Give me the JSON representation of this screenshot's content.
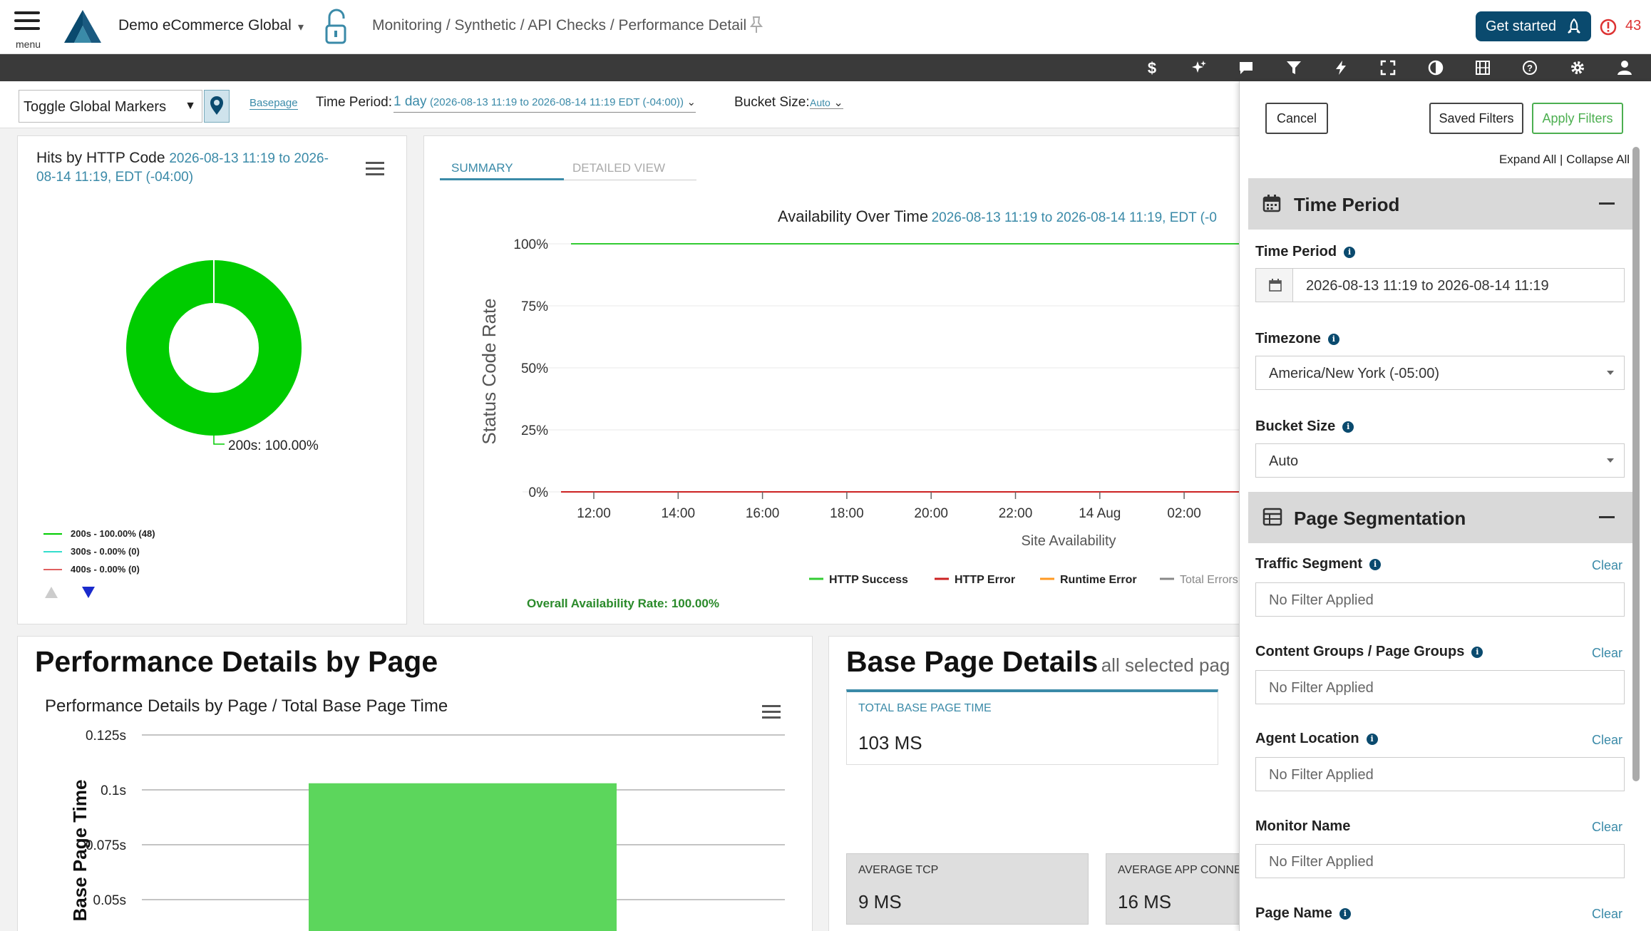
{
  "header": {
    "menu_label": "menu",
    "org_name": "Demo eCommerce Global",
    "breadcrumb": "Monitoring / Synthetic / API Checks / Performance Detail",
    "get_started": "Get started",
    "alert_count": "43",
    "colors": {
      "brand": "#0a4a6e",
      "alert": "#dd3333"
    }
  },
  "toolbar": {
    "icons": [
      "dollar-icon",
      "sparkle-icon",
      "comment-icon",
      "filter-icon",
      "lightning-icon",
      "fullscreen-icon",
      "contrast-icon",
      "film-icon",
      "help-icon",
      "gear-icon",
      "user-icon"
    ]
  },
  "filter_bar": {
    "markers_label": "Toggle Global Markers",
    "basepage_link": "Basepage",
    "time_period_label": "Time Period:",
    "time_period_value": "1 day",
    "time_period_range": "(2026-08-13 11:19 to 2026-08-14 11:19 EDT (-04:00))",
    "bucket_size_label": "Bucket Size:",
    "bucket_size_value": "Auto"
  },
  "http_card": {
    "title": "Hits by HTTP Code",
    "subtitle": "2026-08-13 11:19 to 2026-08-14 11:19, EDT (-04:00)",
    "chart_data": {
      "type": "pie",
      "labels": [
        "200s",
        "300s",
        "400s"
      ],
      "values": [
        100.0,
        0.0,
        0.0
      ],
      "counts": [
        48,
        0,
        0
      ],
      "colors": [
        "#00cc00",
        "#33ddcc",
        "#e06060"
      ],
      "slice_label": "200s: 100.00%",
      "legend": [
        "200s - 100.00% (48)",
        "300s - 0.00% (0)",
        "400s - 0.00% (0)"
      ]
    }
  },
  "availability_card": {
    "tabs": [
      "SUMMARY",
      "DETAILED VIEW"
    ],
    "chart_data": {
      "type": "line",
      "title": "Availability Over Time",
      "subtitle": "2026-08-13 11:19 to 2026-08-14 11:19, EDT (-0",
      "ylabel": "Status Code Rate",
      "xlabel": "Site Availability",
      "yticks": [
        "100%",
        "75%",
        "50%",
        "25%",
        "0%"
      ],
      "xticks": [
        "12:00",
        "14:00",
        "16:00",
        "18:00",
        "20:00",
        "22:00",
        "14 Aug",
        "02:00"
      ],
      "ylim": [
        0,
        100
      ],
      "series": [
        {
          "name": "HTTP Success",
          "color": "#33cc33",
          "value": 100
        },
        {
          "name": "HTTP Error",
          "color": "#cc2222",
          "value": 0
        },
        {
          "name": "Runtime Error",
          "color": "#ff9922",
          "value": 0
        },
        {
          "name": "Total Errors",
          "color": "#888888",
          "value": 0
        }
      ]
    },
    "overall_rate": "Overall Availability Rate: 100.00%"
  },
  "perf_card": {
    "heading": "Performance Details by Page",
    "chart_data": {
      "type": "bar",
      "title": "Performance Details by Page / Total Base Page Time",
      "ylabel": "Base Page Time",
      "yticks": [
        "0.125s",
        "0.1s",
        "0.075s",
        "0.05s"
      ],
      "values": [
        0.103
      ],
      "color": "#5cd65c"
    }
  },
  "base_card": {
    "heading": "Base Page Details",
    "subheading": "all selected pag",
    "metrics": [
      {
        "label": "TOTAL BASE PAGE TIME",
        "value": "103 MS"
      },
      {
        "label": "AVERAGE TCP",
        "value": "9 MS"
      },
      {
        "label": "AVERAGE APP CONNE",
        "value": "16 MS"
      }
    ]
  },
  "panel": {
    "cancel": "Cancel",
    "saved_filters": "Saved Filters",
    "apply_filters": "Apply Filters",
    "expand_all": "Expand All",
    "collapse_all": "Collapse All",
    "time_section": "Time Period",
    "time_period_label": "Time Period",
    "time_period_value": "2026-08-13 11:19 to 2026-08-14 11:19",
    "timezone_label": "Timezone",
    "timezone_value": "America/New York (-05:00)",
    "bucket_label": "Bucket Size",
    "bucket_value": "Auto",
    "seg_section": "Page Segmentation",
    "clear": "Clear",
    "no_filter": "No Filter Applied",
    "traffic_segment": "Traffic Segment",
    "content_groups": "Content Groups / Page Groups",
    "agent_location": "Agent Location",
    "monitor_name": "Monitor Name",
    "page_name": "Page Name",
    "apply_color": "#4caf50"
  }
}
